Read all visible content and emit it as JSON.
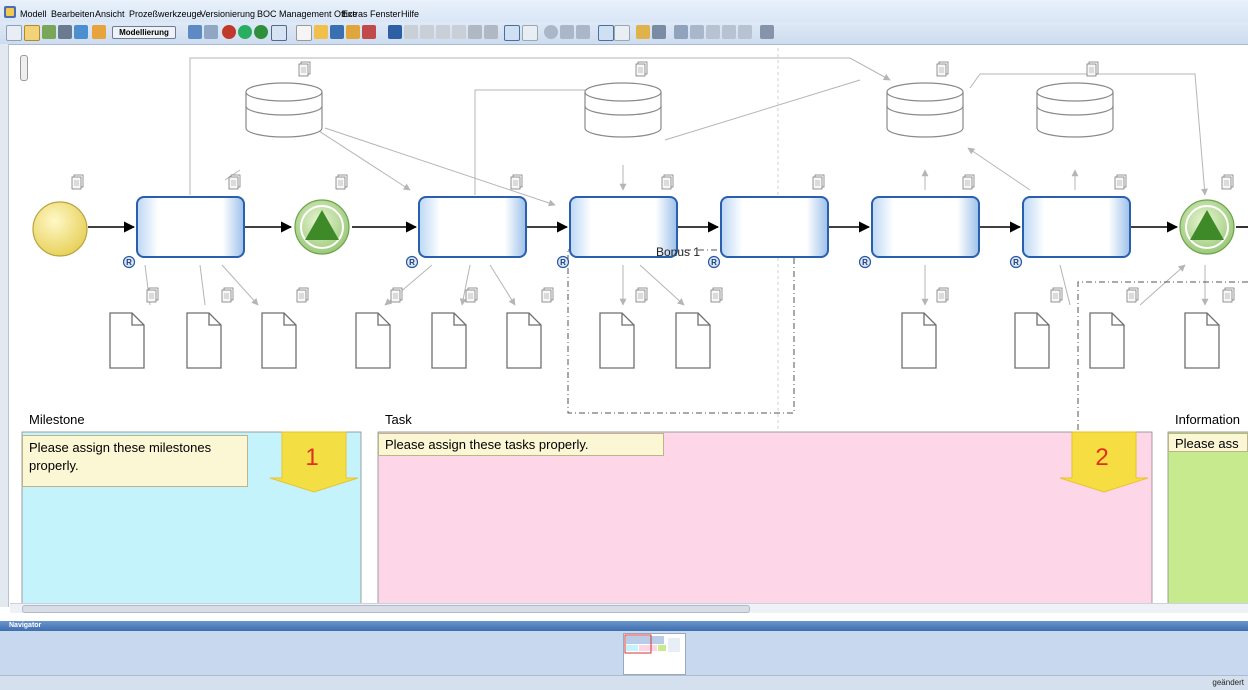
{
  "menubar": {
    "items": [
      "Modell",
      "Bearbeiten",
      "Ansicht",
      "Prozeßwerkzeuge",
      "Versionierung",
      "BOC Management Office",
      "Extras",
      "Fenster",
      "Hilfe"
    ]
  },
  "toolbar": {
    "mode_label": "Modellierung"
  },
  "diagram": {
    "task_overlay_label": "Bonus 1",
    "step_1": "1",
    "step_2": "2"
  },
  "lanes": [
    {
      "title": "Milestone",
      "note": "Please assign these milestones properly.",
      "color": "#c4f3fc"
    },
    {
      "title": "Task",
      "note": "Please assign these tasks properly.",
      "color": "#fdd6e7"
    },
    {
      "title": "Information",
      "note": "Please ass",
      "color": "#c7ea8f"
    }
  ],
  "navigator": {
    "title": "Navigator"
  },
  "status": {
    "text": "geändert"
  }
}
